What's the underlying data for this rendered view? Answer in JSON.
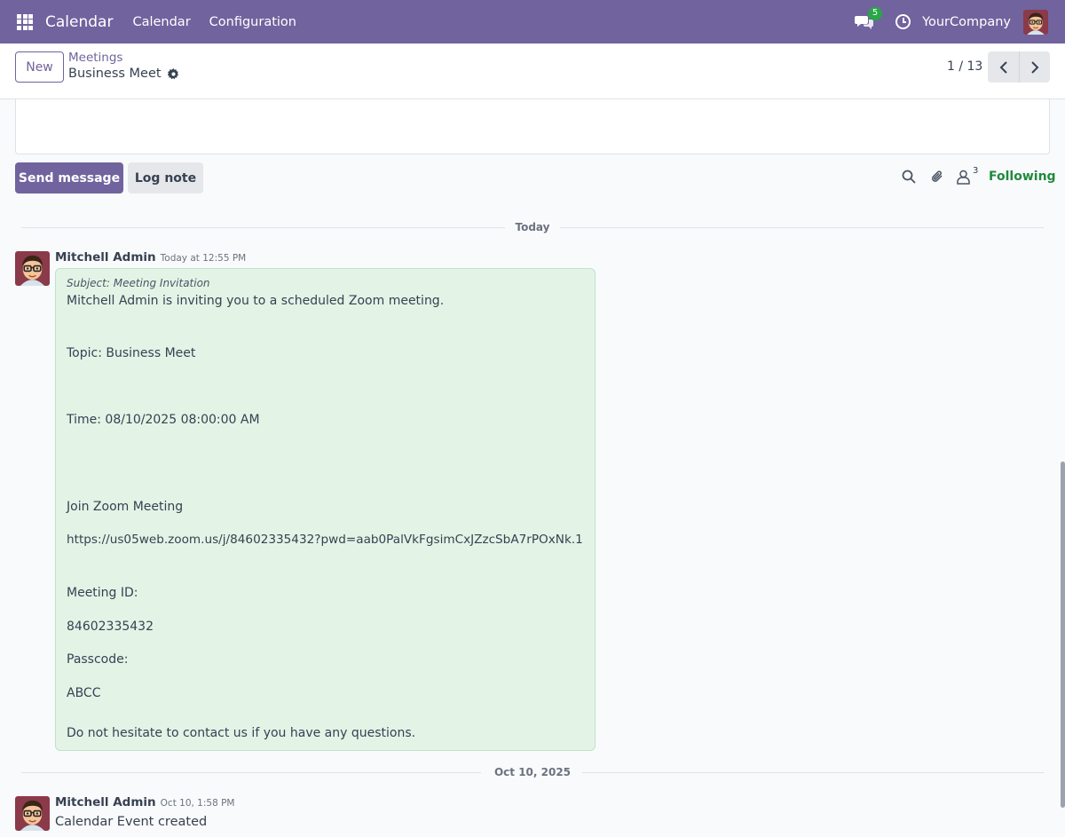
{
  "topbar": {
    "app_title": "Calendar",
    "menus": [
      "Calendar",
      "Configuration"
    ],
    "chat_badge": "5",
    "company": "YourCompany",
    "bg_color": "#71639e"
  },
  "control_panel": {
    "new_label": "New",
    "breadcrumb_parent": "Meetings",
    "breadcrumb_current": "Business Meet",
    "pager_value": "1 / 13"
  },
  "chatter": {
    "send_label": "Send message",
    "log_label": "Log note",
    "follower_count": "3",
    "following_label": "Following",
    "following_color": "#1f8a3c"
  },
  "messages": [
    {
      "separator": "Today",
      "author": "Mitchell Admin",
      "date": "Today at 12:55 PM",
      "subject": "Subject: Meeting Invitation",
      "lines": [
        "Mitchell Admin is inviting you to a scheduled Zoom meeting.",
        "Topic: Business Meet",
        "Time: 08/10/2025 08:00:00 AM",
        "Join Zoom Meeting",
        "https://us05web.zoom.us/j/84602335432?pwd=aab0PalVkFgsimCxJZzcSbA7rPOxNk.1",
        "Meeting ID:",
        "84602335432",
        "Passcode:",
        "ABCC",
        "Do not hesitate to contact us if you have any questions."
      ],
      "bubble_color": "#e3f4e7"
    },
    {
      "separator": "Oct 10, 2025",
      "author": "Mitchell Admin",
      "date": "Oct 10, 1:58 PM",
      "body": "Calendar Event created"
    }
  ]
}
